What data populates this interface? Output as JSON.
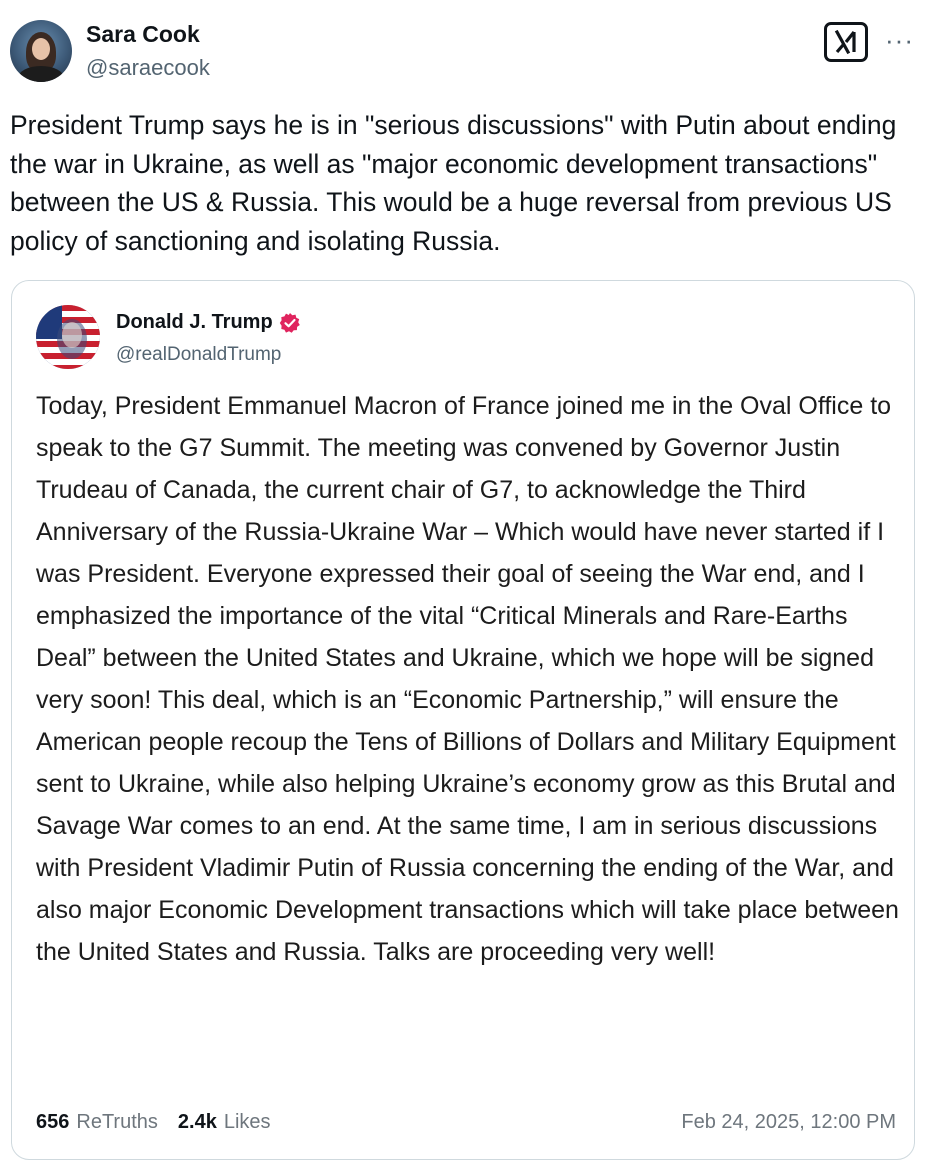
{
  "tweet": {
    "author_name": "Sara Cook",
    "author_handle": "@saraecook",
    "text": "President Trump says he is in \"serious discussions\" with Putin about ending the war in Ukraine, as well as \"major economic development transactions\" between the US & Russia. This would be a huge reversal from previous US policy of sanctioning and isolating Russia.",
    "grok_icon": "grok-icon",
    "more_icon": "more-dots-icon",
    "more_label": "···"
  },
  "quoted_post": {
    "author_name": "Donald J. Trump",
    "author_handle": "@realDonaldTrump",
    "verified_color": "#e0245e",
    "text": "Today, President Emmanuel Macron of France joined me in the Oval Office to speak to the G7 Summit. The meeting was convened by Governor Justin Trudeau of Canada, the current chair of G7, to acknowledge the Third Anniversary of the Russia-Ukraine War – Which would have never started if I was President. Everyone expressed their goal of seeing the War end, and I emphasized the importance of the vital “Critical Minerals and Rare-Earths Deal” between the United States and Ukraine, which we hope will be signed very soon! This deal, which is an “Economic Partnership,” will ensure the American people recoup the Tens of Billions of Dollars and Military Equipment sent to Ukraine, while also helping Ukraine’s economy grow as this Brutal and Savage War comes to an end. At the same time, I am in serious discussions with President Vladimir Putin of Russia concerning the ending of the War, and also major Economic Development transactions which will take place between the United States and Russia. Talks are proceeding very well!",
    "retruths_count": "656",
    "retruths_label": "ReTruths",
    "likes_count": "2.4k",
    "likes_label": "Likes",
    "timestamp": "Feb 24, 2025, 12:00 PM"
  }
}
